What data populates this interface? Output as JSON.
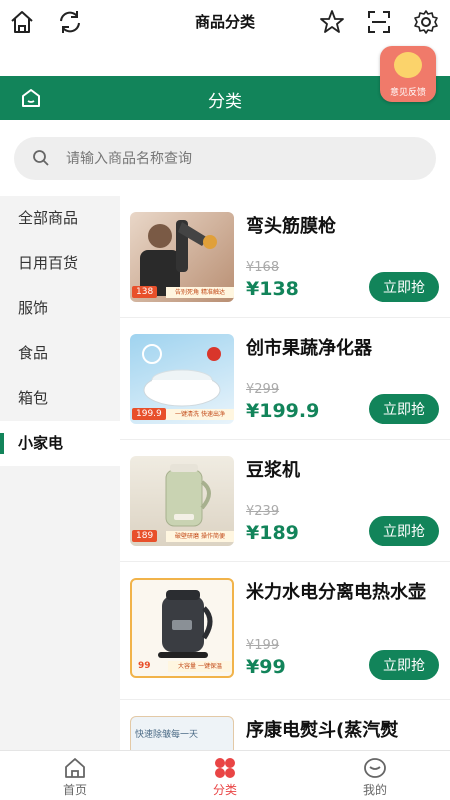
{
  "topbar": {
    "title": "商品分类",
    "icons": [
      "home-outline-icon",
      "refresh-icon",
      "star-icon",
      "scan-icon",
      "gear-icon"
    ]
  },
  "feedback": {
    "label": "意见反馈"
  },
  "header": {
    "title": "分类"
  },
  "search": {
    "placeholder": "请输入商品名称查询",
    "value": ""
  },
  "sidebar": {
    "active_index": 5,
    "items": [
      {
        "label": "全部商品"
      },
      {
        "label": "日用百货"
      },
      {
        "label": "服饰"
      },
      {
        "label": "食品"
      },
      {
        "label": "箱包"
      },
      {
        "label": "小家电"
      }
    ]
  },
  "products": [
    {
      "name": "弯头筋膜枪",
      "old_price": "¥168",
      "price": "¥138",
      "button": "立即抢",
      "thumb_price": "138",
      "thumb_strip": "告别死角 精准触达"
    },
    {
      "name": "创市果蔬净化器",
      "old_price": "¥299",
      "price": "¥199.9",
      "button": "立即抢",
      "thumb_price": "199.9",
      "thumb_strip": "一键清洗 快速出净"
    },
    {
      "name": "豆浆机",
      "old_price": "¥239",
      "price": "¥189",
      "button": "立即抢",
      "thumb_price": "189",
      "thumb_strip": "破壁研磨 操作简便"
    },
    {
      "name": "米力水电分离电热水壶",
      "old_price": "¥199",
      "price": "¥99",
      "button": "立即抢",
      "thumb_price": "99",
      "thumb_strip": "大容量 一键保温"
    },
    {
      "name": "序康电熨斗(蒸汽熨",
      "thumb_banner": "快速除皱每一天"
    }
  ],
  "bottomnav": {
    "active_index": 1,
    "items": [
      {
        "label": "首页",
        "icon": "home-icon"
      },
      {
        "label": "分类",
        "icon": "category-icon"
      },
      {
        "label": "我的",
        "icon": "profile-icon"
      }
    ]
  },
  "colors": {
    "brand": "#12845a",
    "active_tab": "#e94545"
  }
}
